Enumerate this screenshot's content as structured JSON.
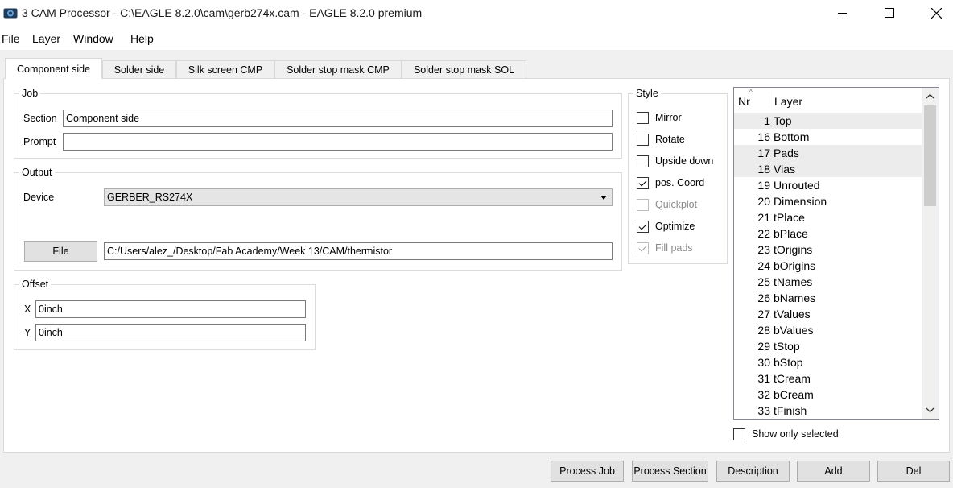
{
  "window": {
    "title": "3 CAM Processor - C:\\EAGLE 8.2.0\\cam\\gerb274x.cam - EAGLE 8.2.0 premium"
  },
  "menu": [
    "File",
    "Layer",
    "Window",
    "Help"
  ],
  "tabs": [
    "Component side",
    "Solder side",
    "Silk screen CMP",
    "Solder stop mask CMP",
    "Solder stop mask SOL"
  ],
  "job": {
    "group_label": "Job",
    "section_label": "Section",
    "section_value": "Component side",
    "prompt_label": "Prompt",
    "prompt_value": ""
  },
  "output": {
    "group_label": "Output",
    "device_label": "Device",
    "device_value": "GERBER_RS274X",
    "file_button": "File",
    "file_value": "C:/Users/alez_/Desktop/Fab Academy/Week 13/CAM/thermistor"
  },
  "offset": {
    "group_label": "Offset",
    "x_label": "X",
    "x_value": "0inch",
    "y_label": "Y",
    "y_value": "0inch"
  },
  "style": {
    "group_label": "Style",
    "options": [
      {
        "label": "Mirror",
        "checked": false,
        "enabled": true
      },
      {
        "label": "Rotate",
        "checked": false,
        "enabled": true
      },
      {
        "label": "Upside down",
        "checked": false,
        "enabled": true
      },
      {
        "label": "pos. Coord",
        "checked": true,
        "enabled": true
      },
      {
        "label": "Quickplot",
        "checked": false,
        "enabled": false
      },
      {
        "label": "Optimize",
        "checked": true,
        "enabled": true
      },
      {
        "label": "Fill pads",
        "checked": true,
        "enabled": false
      }
    ]
  },
  "layers": {
    "col_nr": "Nr",
    "col_layer": "Layer",
    "rows": [
      {
        "nr": "1",
        "name": "Top",
        "selected": true
      },
      {
        "nr": "16",
        "name": "Bottom",
        "selected": false
      },
      {
        "nr": "17",
        "name": "Pads",
        "selected": true
      },
      {
        "nr": "18",
        "name": "Vias",
        "selected": true
      },
      {
        "nr": "19",
        "name": "Unrouted",
        "selected": false
      },
      {
        "nr": "20",
        "name": "Dimension",
        "selected": false
      },
      {
        "nr": "21",
        "name": "tPlace",
        "selected": false
      },
      {
        "nr": "22",
        "name": "bPlace",
        "selected": false
      },
      {
        "nr": "23",
        "name": "tOrigins",
        "selected": false
      },
      {
        "nr": "24",
        "name": "bOrigins",
        "selected": false
      },
      {
        "nr": "25",
        "name": "tNames",
        "selected": false
      },
      {
        "nr": "26",
        "name": "bNames",
        "selected": false
      },
      {
        "nr": "27",
        "name": "tValues",
        "selected": false
      },
      {
        "nr": "28",
        "name": "bValues",
        "selected": false
      },
      {
        "nr": "29",
        "name": "tStop",
        "selected": false
      },
      {
        "nr": "30",
        "name": "bStop",
        "selected": false
      },
      {
        "nr": "31",
        "name": "tCream",
        "selected": false
      },
      {
        "nr": "32",
        "name": "bCream",
        "selected": false
      },
      {
        "nr": "33",
        "name": "tFinish",
        "selected": false
      }
    ],
    "show_only_selected": "Show only selected"
  },
  "buttons": {
    "process_job": "Process Job",
    "process_section": "Process Section",
    "description": "Description",
    "add": "Add",
    "del": "Del"
  }
}
